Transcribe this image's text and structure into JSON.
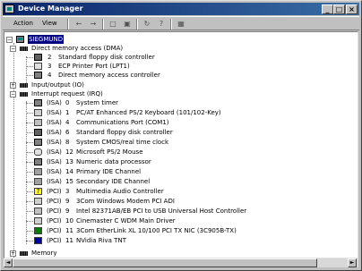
{
  "window": {
    "title": "Device Manager"
  },
  "titlebar_buttons": {
    "minimize": "_",
    "maximize": "□",
    "close": "×"
  },
  "menu": {
    "action": "Action",
    "view": "View"
  },
  "toolbar_icons": [
    "back-icon",
    "forward-icon",
    "up-folder-icon",
    "properties-icon",
    "refresh-icon",
    "help-icon",
    "scan-icon"
  ],
  "tree": {
    "root": "SIEGMUND",
    "dma": {
      "label": "Direct memory access (DMA)",
      "items": [
        {
          "num": "2",
          "name": "Standard floppy disk controller",
          "icon": "floppy"
        },
        {
          "num": "3",
          "name": "ECP Printer Port (LPT1)",
          "icon": "printer"
        },
        {
          "num": "4",
          "name": "Direct memory access controller",
          "icon": "chip"
        }
      ]
    },
    "io": {
      "label": "Input/output (IO)"
    },
    "irq": {
      "label": "Interrupt request (IRQ)",
      "items": [
        {
          "bus": "(ISA)",
          "num": "0",
          "name": "System timer",
          "icon": "chip"
        },
        {
          "bus": "(ISA)",
          "num": "1",
          "name": "PC/AT Enhanced PS/2 Keyboard (101/102-Key)",
          "icon": "keyboard"
        },
        {
          "bus": "(ISA)",
          "num": "4",
          "name": "Communications Port (COM1)",
          "icon": "port"
        },
        {
          "bus": "(ISA)",
          "num": "6",
          "name": "Standard floppy disk controller",
          "icon": "floppy"
        },
        {
          "bus": "(ISA)",
          "num": "8",
          "name": "System CMOS/real time clock",
          "icon": "chip"
        },
        {
          "bus": "(ISA)",
          "num": "12",
          "name": "Microsoft PS/2 Mouse",
          "icon": "mouse"
        },
        {
          "bus": "(ISA)",
          "num": "13",
          "name": "Numeric data processor",
          "icon": "chip"
        },
        {
          "bus": "(ISA)",
          "num": "14",
          "name": "Primary IDE Channel",
          "icon": "ide"
        },
        {
          "bus": "(ISA)",
          "num": "15",
          "name": "Secondary IDE Channel",
          "icon": "ide"
        },
        {
          "bus": "(PCI)",
          "num": "3",
          "name": "Multimedia Audio Controller",
          "icon": "question"
        },
        {
          "bus": "(PCI)",
          "num": "9",
          "name": "3Com Windows Modem PCI ADI",
          "icon": "modem"
        },
        {
          "bus": "(PCI)",
          "num": "9",
          "name": "Intel 82371AB/EB PCI to USB Universal Host Controller",
          "icon": "usb"
        },
        {
          "bus": "(PCI)",
          "num": "10",
          "name": "Cinemaster C WDM Main Driver",
          "icon": "sound"
        },
        {
          "bus": "(PCI)",
          "num": "11",
          "name": "3Com EtherLink XL 10/100 PCI TX NIC (3C905B-TX)",
          "icon": "nic"
        },
        {
          "bus": "(PCI)",
          "num": "11",
          "name": "NVidia Riva TNT",
          "icon": "display"
        }
      ]
    },
    "memory": {
      "label": "Memory"
    }
  },
  "scrollbar": {
    "left": "◄",
    "right": "►"
  }
}
